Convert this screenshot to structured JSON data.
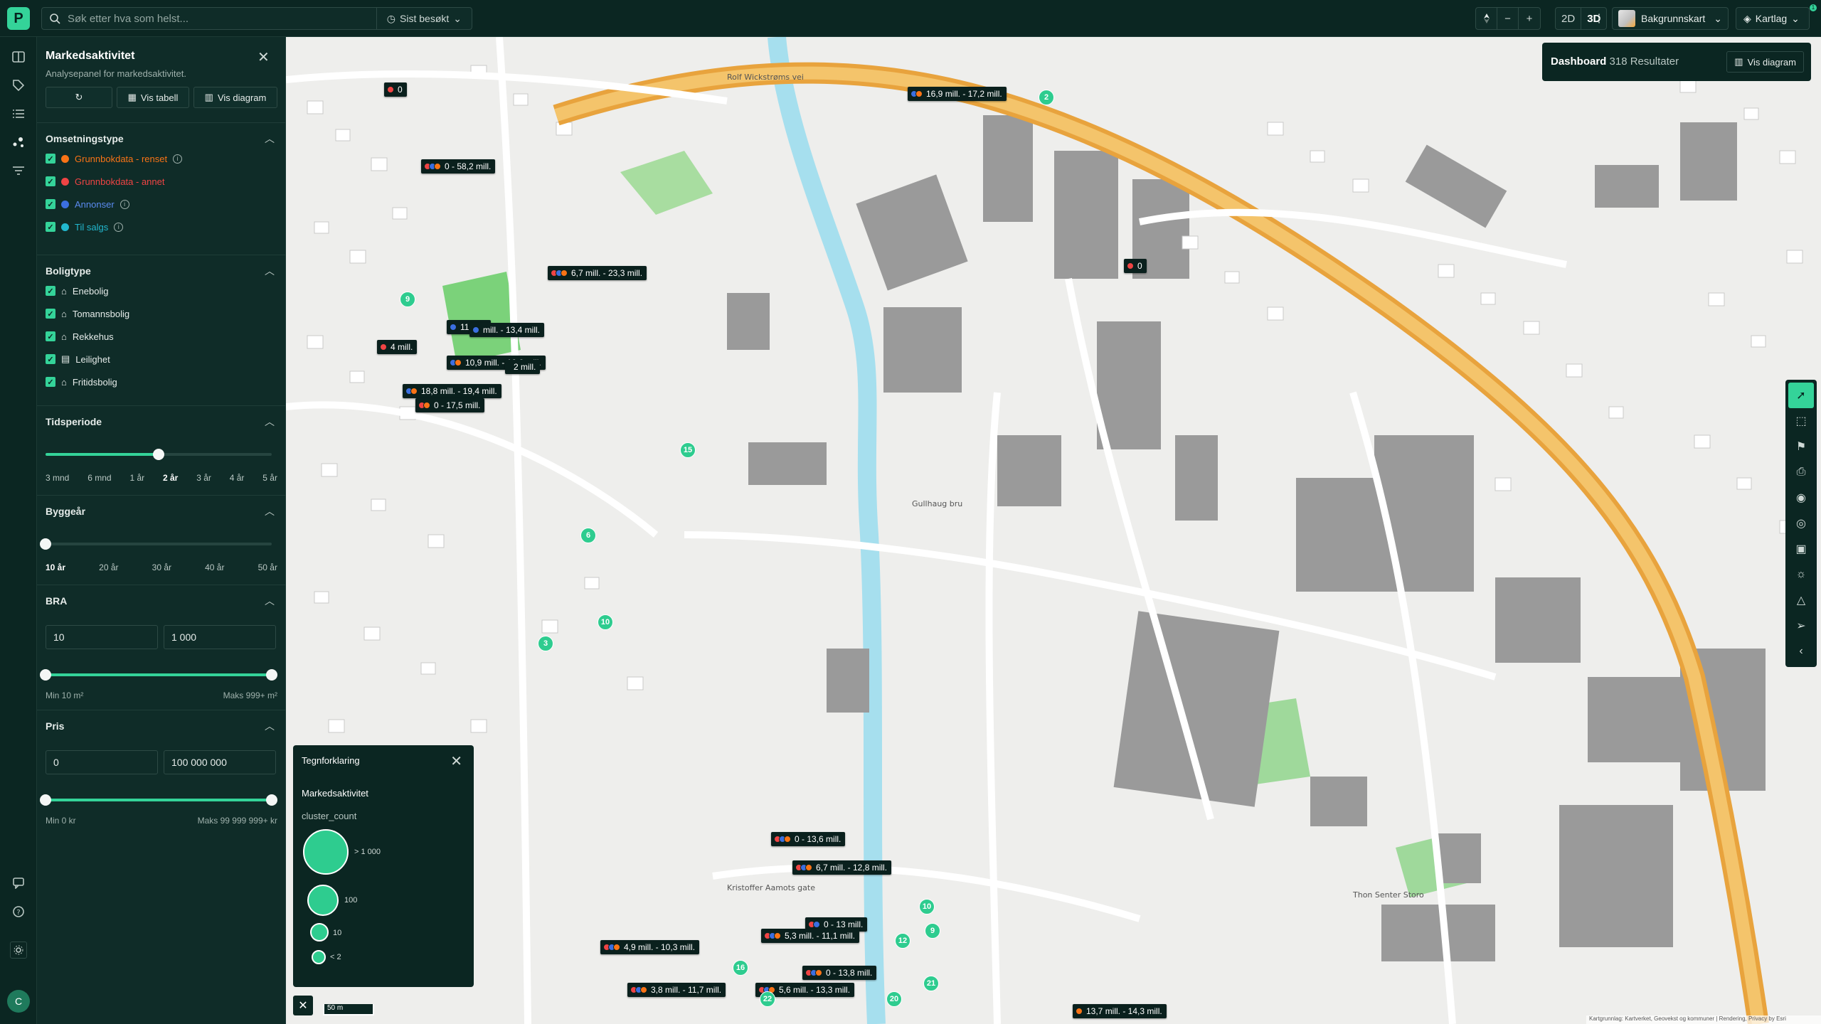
{
  "topbar": {
    "logo_letter": "P",
    "search_placeholder": "Søk etter hva som helst...",
    "recent_label": "Sist besøkt",
    "zoom_out": "−",
    "zoom_in": "+",
    "view_2d": "2D",
    "view_3d": "3D",
    "background_label": "Bakgrunnskart",
    "layers_label": "Kartlag",
    "notification_count": "1"
  },
  "rail": {
    "avatar_letter": "C"
  },
  "panel": {
    "title": "Markedsaktivitet",
    "subtitle": "Analysepanel for markedsaktivitet.",
    "table_button": "Vis tabell",
    "diagram_button": "Vis diagram",
    "sections": {
      "omsetningstype": {
        "title": "Omsetningstype",
        "items": [
          {
            "label": "Grunnbokdata - renset",
            "color": "#f97316"
          },
          {
            "label": "Grunnbokdata - annet",
            "color": "#ef4444"
          },
          {
            "label": "Annonser",
            "color": "#3b6fe0"
          },
          {
            "label": "Til salgs",
            "color": "#22b8cf"
          }
        ]
      },
      "boligtype": {
        "title": "Boligtype",
        "items": [
          "Enebolig",
          "Tomannsbolig",
          "Rekkehus",
          "Leilighet",
          "Fritidsbolig"
        ]
      },
      "tidsperiode": {
        "title": "Tidsperiode",
        "ticks": [
          "3 mnd",
          "6 mnd",
          "1 år",
          "2 år",
          "3 år",
          "4 år",
          "5 år"
        ],
        "selected": "2 år",
        "value_fraction": 0.5
      },
      "byggear": {
        "title": "Byggeår",
        "ticks": [
          "10 år",
          "20 år",
          "30 år",
          "40 år",
          "50 år"
        ],
        "selected": "10 år",
        "value_fraction": 0.0
      },
      "bra": {
        "title": "BRA",
        "min_value": "10",
        "max_value": "1 000",
        "min_label": "Min 10 m²",
        "max_label": "Maks 999+ m²"
      },
      "pris": {
        "title": "Pris",
        "min_value": "0",
        "max_value": "100 000 000",
        "min_label": "Min 0 kr",
        "max_label": "Maks 99 999 999+ kr"
      }
    }
  },
  "dashboard": {
    "title": "Dashboard",
    "count": "318 Resultater",
    "button": "Vis diagram"
  },
  "legend": {
    "title": "Tegnforklaring",
    "section": "Markedsaktivitet",
    "subtitle": "cluster_count",
    "levels": [
      "> 1 000",
      "100",
      "10",
      "< 2"
    ]
  },
  "scale_label": "50 m",
  "attribution": "Kartgrunnlag: Kartverket, Geovekst og kommuner | Rendering, Privacy by Esri",
  "map_markers": [
    {
      "label": "0",
      "colors": [
        "#ef4444"
      ]
    },
    {
      "label": "0 - 58,2 mill.",
      "colors": [
        "#ef4444",
        "#3b6fe0",
        "#f97316"
      ]
    },
    {
      "label": "4 mill.",
      "colors": [
        "#ef4444"
      ]
    },
    {
      "label": "18,8 mill. - 19,4 mill.",
      "colors": [
        "#3b6fe0",
        "#f97316"
      ]
    },
    {
      "label": "0 - 17,5 mill.",
      "colors": [
        "#ef4444",
        "#f97316"
      ]
    },
    {
      "label": "11 mill.",
      "colors": [
        "#3b6fe0"
      ]
    },
    {
      "label": "mill. - 13,4 mill.",
      "colors": [
        "#3b6fe0"
      ]
    },
    {
      "label": "10,9 mill. - 12,6 mill.",
      "colors": [
        "#3b6fe0",
        "#f97316"
      ]
    },
    {
      "label": "2 mill.",
      "colors": []
    },
    {
      "label": "6,7 mill. - 23,3 mill.",
      "colors": [
        "#ef4444",
        "#3b6fe0",
        "#f97316"
      ]
    },
    {
      "label": "16,9 mill. - 17,2 mill.",
      "colors": [
        "#3b6fe0",
        "#f97316"
      ]
    },
    {
      "label": "0",
      "colors": [
        "#ef4444"
      ]
    },
    {
      "label": "0 - 13,6 mill.",
      "colors": [
        "#ef4444",
        "#3b6fe0",
        "#f97316"
      ]
    },
    {
      "label": "6,7 mill. - 12,8 mill.",
      "colors": [
        "#ef4444",
        "#3b6fe0",
        "#f97316"
      ]
    },
    {
      "label": "0 - 13 mill.",
      "colors": [
        "#ef4444",
        "#3b6fe0"
      ]
    },
    {
      "label": "5,3 mill. - 11,1 mill.",
      "colors": [
        "#ef4444",
        "#3b6fe0",
        "#f97316"
      ]
    },
    {
      "label": "0 - 13,8 mill.",
      "colors": [
        "#ef4444",
        "#3b6fe0",
        "#f97316"
      ]
    },
    {
      "label": "5,6 mill. - 13,3 mill.",
      "colors": [
        "#ef4444",
        "#3b6fe0",
        "#f97316"
      ]
    },
    {
      "label": "4,9 mill. - 10,3 mill.",
      "colors": [
        "#ef4444",
        "#3b6fe0",
        "#f97316"
      ]
    },
    {
      "label": "3,8 mill. - 11,7 mill.",
      "colors": [
        "#ef4444",
        "#3b6fe0",
        "#f97316"
      ]
    },
    {
      "label": "13,7 mill. - 14,3 mill.",
      "colors": [
        "#f97316"
      ]
    }
  ],
  "map_clusters": [
    "9",
    "15",
    "6",
    "10",
    "3",
    "16",
    "22",
    "20",
    "12",
    "9",
    "10",
    "2",
    "21"
  ]
}
